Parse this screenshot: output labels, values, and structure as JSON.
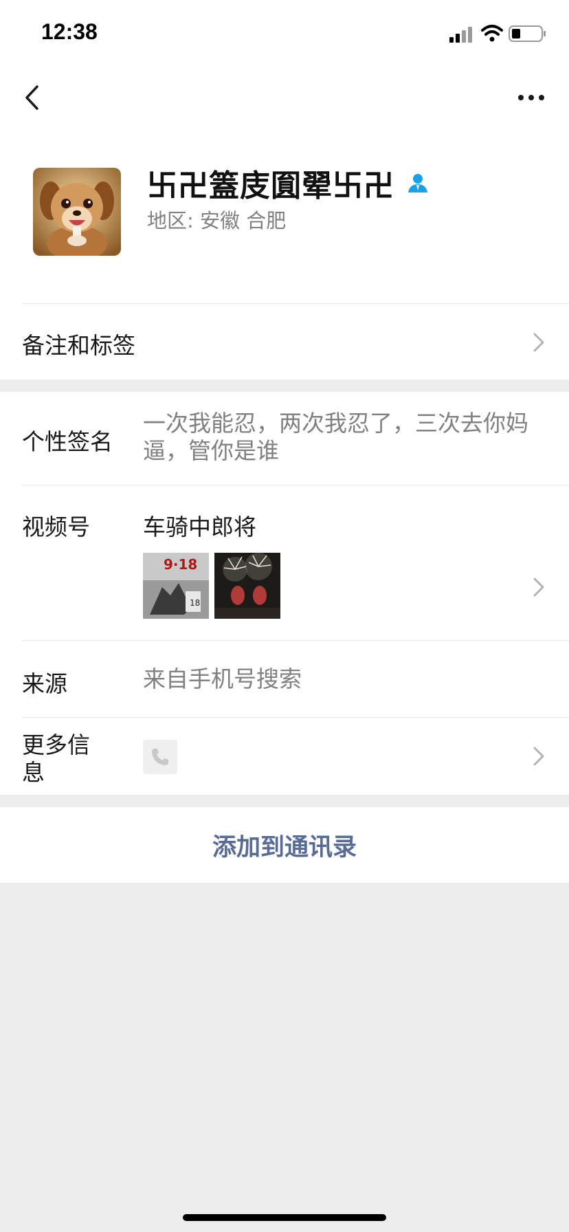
{
  "status_bar": {
    "time": "12:38",
    "icons": [
      "signal-icon",
      "wifi-icon",
      "battery-icon"
    ]
  },
  "nav": {
    "back_icon": "chevron-left-icon",
    "more_icon": "more-dots-icon"
  },
  "profile": {
    "nickname": "卐卍篕庋圎翚卐卍",
    "verified_icon": "person-badge-icon",
    "region_label": "地区:",
    "region_value": "安徽 合肥"
  },
  "rows": {
    "remark": {
      "label": "备注和标签"
    },
    "signature": {
      "label": "个性签名",
      "value": "一次我能忍，两次我忍了，三次去你妈逼，管你是谁"
    },
    "channels": {
      "label": "视频号",
      "name": "车骑中郎将",
      "thumb1_text": "9·18",
      "thumb1_small": "18"
    },
    "source": {
      "label": "来源",
      "value": "来自手机号搜索"
    },
    "more_info": {
      "label": "更多信息",
      "icon": "phone-icon"
    }
  },
  "actions": {
    "add_contact": "添加到通讯录"
  },
  "colors": {
    "link": "#576b95",
    "secondary_text": "#808080",
    "background": "#ededed",
    "verified": "#1aa0e6"
  }
}
